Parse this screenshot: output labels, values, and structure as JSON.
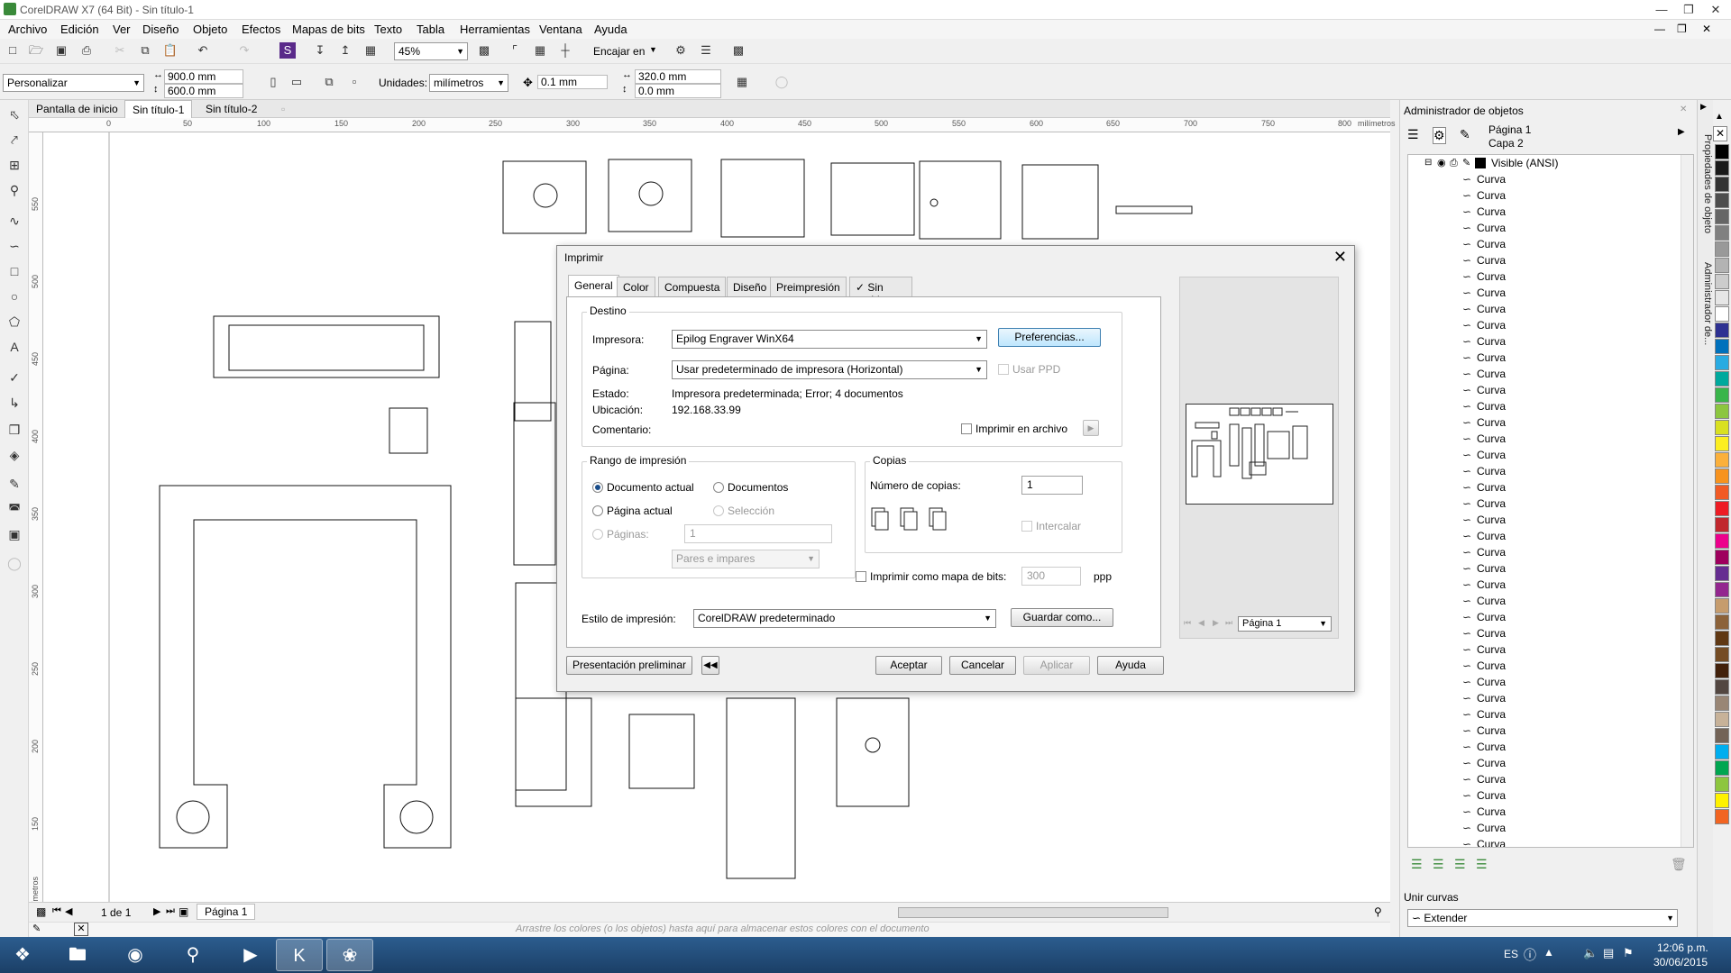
{
  "window": {
    "title": "CorelDRAW X7 (64 Bit) - Sin título-1"
  },
  "menu": [
    "Archivo",
    "Edición",
    "Ver",
    "Diseño",
    "Objeto",
    "Efectos",
    "Mapas de bits",
    "Texto",
    "Tabla",
    "Herramientas",
    "Ventana",
    "Ayuda"
  ],
  "toolbar": {
    "zoom": "45%",
    "snap": "Encajar en"
  },
  "propbar": {
    "preset": "Personalizar",
    "width": "900.0 mm",
    "height": "600.0 mm",
    "units_label": "Unidades:",
    "units": "milímetros",
    "nudge": "0.1 mm",
    "dup_x": "320.0 mm",
    "dup_y": "0.0 mm"
  },
  "doc_tabs": [
    "Pantalla de inicio",
    "Sin título-1",
    "Sin título-2"
  ],
  "ruler": {
    "h": [
      "0",
      "50",
      "100",
      "150",
      "200",
      "250",
      "300",
      "350",
      "400",
      "450",
      "500",
      "550",
      "600",
      "650",
      "700",
      "750",
      "800"
    ],
    "h_unit": "milímetros",
    "v": [
      "550",
      "500",
      "450",
      "400",
      "350",
      "300",
      "250",
      "200",
      "150"
    ],
    "v_unit": "milímetros"
  },
  "page_nav": {
    "count": "1 de 1",
    "page_tab": "Página 1"
  },
  "palette_hint": "Arrastre los colores (o los objetos) hasta aquí para almacenar estos colores con el documento",
  "dialog": {
    "title": "Imprimir",
    "tabs": [
      "General",
      "Color",
      "Compuesta",
      "Diseño",
      "Preimpresión",
      "Sin problemas"
    ],
    "destino_title": "Destino",
    "printer_label": "Impresora:",
    "printer": "Epilog Engraver WinX64",
    "preferences_btn": "Preferencias...",
    "page_label": "Página:",
    "page": "Usar predeterminado de impresora (Horizontal)",
    "use_ppd": "Usar PPD",
    "status_label": "Estado:",
    "status": "Impresora predeterminada; Error; 4 documentos",
    "location_label": "Ubicación:",
    "location": "192.168.33.99",
    "comment_label": "Comentario:",
    "print_to_file": "Imprimir en archivo",
    "range_title": "Rango de impresión",
    "range_current_doc": "Documento actual",
    "range_documents": "Documentos",
    "range_current_page": "Página actual",
    "range_selection": "Selección",
    "range_pages": "Páginas:",
    "pages_value": "1",
    "odd_even": "Pares e impares",
    "copies_title": "Copias",
    "copies_label": "Número de copias:",
    "copies_value": "1",
    "collate": "Intercalar",
    "bitmap_label": "Imprimir como mapa de bits:",
    "bitmap_dpi": "300",
    "dpi_unit": "ppp",
    "style_label": "Estilo de impresión:",
    "style": "CorelDRAW predeterminado",
    "save_as_btn": "Guardar como...",
    "preview_btn": "Presentación preliminar",
    "ok_btn": "Aceptar",
    "cancel_btn": "Cancelar",
    "apply_btn": "Aplicar",
    "help_btn": "Ayuda",
    "preview_page": "Página 1"
  },
  "docker": {
    "title": "Administrador de objetos",
    "page": "Página 1",
    "layer": "Capa 2",
    "root": "Visible (ANSI)",
    "item_label": "Curva",
    "item_count": 43,
    "join_title": "Unir curvas",
    "join_mode": "Extender"
  },
  "vtabs": [
    "Propiedades de objeto",
    "Administrador de..."
  ],
  "taskbar": {
    "lang": "ES",
    "time": "12:06 p.m.",
    "date": "30/06/2015"
  },
  "colors": {
    "palette": [
      "#000000",
      "#1a1a1a",
      "#333333",
      "#4d4d4d",
      "#666666",
      "#808080",
      "#999999",
      "#b3b3b3",
      "#cccccc",
      "#e6e6e6",
      "#ffffff",
      "#2e3192",
      "#0071bc",
      "#29abe2",
      "#00a99d",
      "#39b54a",
      "#8cc63f",
      "#d9e021",
      "#fcee21",
      "#fbb03b",
      "#f7931e",
      "#f15a24",
      "#ed1c24",
      "#c1272d",
      "#ec008c",
      "#9e005d",
      "#662d91",
      "#93278f",
      "#c69c6d",
      "#8c6239",
      "#603813",
      "#754c24",
      "#42210b",
      "#534741",
      "#998675",
      "#c7b299",
      "#736357",
      "#00aeef",
      "#00a651",
      "#8dc63f",
      "#fff200",
      "#f26522"
    ]
  }
}
